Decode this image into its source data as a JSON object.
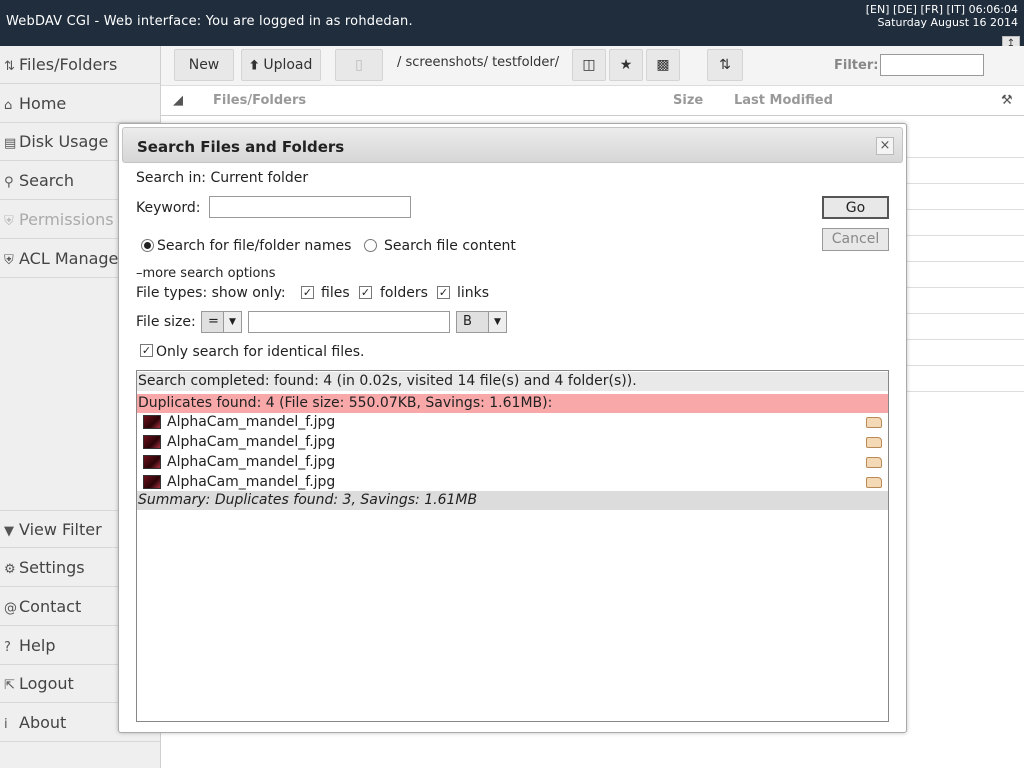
{
  "header": {
    "title": "WebDAV CGI - Web interface: You are logged in as rohdedan.",
    "languages": [
      "[EN]",
      "[DE]",
      "[FR]",
      "[IT]"
    ],
    "time": "06:06:04",
    "date": "Saturday August 16 2014"
  },
  "sidebar": {
    "items": [
      {
        "label": "Files/Folders",
        "icon": "files-folders-icon"
      },
      {
        "label": "Home",
        "icon": "home-icon"
      },
      {
        "label": "Disk Usage",
        "icon": "disk-usage-icon"
      },
      {
        "label": "Search",
        "icon": "search-icon"
      },
      {
        "label": "Permissions",
        "icon": "shield-icon",
        "disabled": true
      },
      {
        "label": "ACL Manager",
        "icon": "shield-icon"
      }
    ],
    "bottom_items": [
      {
        "label": "View Filter",
        "icon": "filter-icon"
      },
      {
        "label": "Settings",
        "icon": "gear-icon"
      },
      {
        "label": "Contact",
        "icon": "at-icon"
      },
      {
        "label": "Help",
        "icon": "question-icon"
      },
      {
        "label": "Logout",
        "icon": "logout-icon"
      },
      {
        "label": "About",
        "icon": "info-icon"
      }
    ]
  },
  "toolbar": {
    "new_label": "New",
    "upload_label": "Upload",
    "path": "/ screenshots/ testfolder/",
    "filter_label": "Filter:"
  },
  "table": {
    "col_name": "Files/Folders",
    "col_size": "Size",
    "col_modified": "Last Modified"
  },
  "dialog": {
    "title": "Search Files and Folders",
    "search_in": "Search in: Current folder",
    "keyword_label": "Keyword:",
    "keyword_value": "",
    "go_label": "Go",
    "cancel_label": "Cancel",
    "radio_names": "Search for file/folder names",
    "radio_content": "Search file content",
    "more_options": "more search options",
    "file_types_label": "File types: show only:",
    "type_files": "files",
    "type_folders": "folders",
    "type_links": "links",
    "file_size_label": "File size:",
    "size_operator": "=",
    "size_unit": "B",
    "identical_label": "Only search for identical files."
  },
  "results": {
    "completed": "Search completed: found: 4 (in 0.02s, visited 14 file(s) and 4 folder(s)).",
    "duplicates": "Duplicates found: 4 (File size: 550.07KB, Savings: 1.61MB):",
    "files": [
      "AlphaCam_mandel_f.jpg",
      "AlphaCam_mandel_f.jpg",
      "AlphaCam_mandel_f.jpg",
      "AlphaCam_mandel_f.jpg"
    ],
    "summary": "Summary: Duplicates found: 3, Savings: 1.61MB"
  },
  "colors": {
    "header_bg": "#1f2d3d",
    "duplicate_highlight": "#f8a8a8"
  }
}
